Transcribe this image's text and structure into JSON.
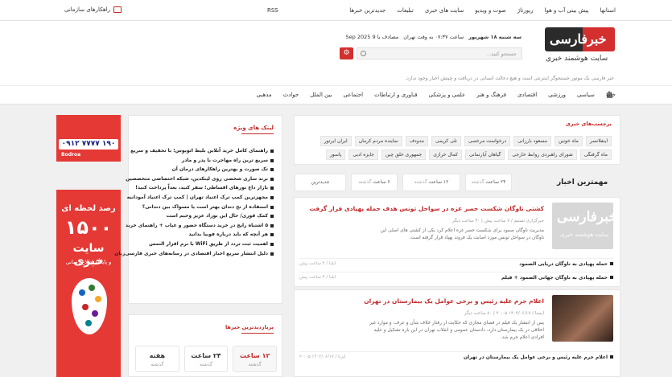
{
  "topbar": {
    "links": [
      "استانها",
      "پیش بینی آب و هوا",
      "ریورتاژ",
      "صوت و ویدیو",
      "سایت های خبری",
      "تبلیغات",
      "جدیدترین خبرها"
    ],
    "rss": "RSS",
    "org_solutions": "راهکارهای سازمانی"
  },
  "header": {
    "logo_text": "خبرفارسی",
    "site_subtitle": "سایت هوشمند خبری",
    "date_persian": "سه شنبه ۱۸ شهریور",
    "time": "ساعت ۰۷:۳۷ به وقت تهران",
    "date_greg": "مصادف با 9 Sep 2025",
    "search_placeholder": "جستجو کنید...",
    "settings_icon": "gear-icon",
    "tagline": "خبر فارسی یک موتور جستجوگر اینترنتی است و هیچ دخالت انسانی در دریافت و چینش اخبار وجود ندارد."
  },
  "mainnav": {
    "items": [
      "خانه",
      "سیاسی",
      "ورزشی",
      "اقتصادی",
      "فرهنگ و هنر",
      "علمی و پزشکی",
      "فناوری و ارتباطات",
      "اجتماعی",
      "بین الملل",
      "حوادث",
      "مذهبی"
    ]
  },
  "ads": {
    "ad1_phone": "۰۹۱۲ ۷۷۷۷ ۱۹۰",
    "ad1_brand": "Bodroa",
    "ad2_line1": "رصد لحظه ای",
    "ad2_line2": "۱۵۰۰",
    "ad2_line3": "سایت خبری",
    "ad2_line4": "و پایگاه اطلاع رسانی"
  },
  "special_links": {
    "title": "لینک های ویژه",
    "items": [
      "راهنمای کامل خرید آنلاین بلیط اتوبوس؛ با تخفیف و سریع",
      "سریع ترین راه مهاجرت با پدر و مادر",
      "تک صورت و بهترین راهکارهای درمان آن",
      "برند سازی شخصی روی لینکدین، شبکه اختصاصی متخصصین",
      "بازار داغ تورهای اقساطی؛ سفر کنید، بعداً پرداخت کنید!",
      "مجهزترین کمپ ترک اعتیاد تهران | کمپ ترک اعتیاد آمودانیه",
      "استفاده از نخ دندان بهتر است یا مسواک بین دندانی؟",
      "کمک فوری/ حال این نوزاد عزیز وخیم است",
      "۵ اشتباه رایج در خرید دستگاه حضور و غیاب + راهنمای خرید",
      "هر آنچه که باید درباره فوبیا بدانید",
      "اهمیت ثبت تردد از طریق WiFi با نرم افزار التمس",
      "دلیل انتشار سریع اخبار اقتصادی در رسانه‌های خبری فارسی‌زبان"
    ]
  },
  "popular": {
    "title": "پربازدیدترین خبرها",
    "tabs": [
      {
        "num": "۱۲ ساعت",
        "sub": "گذشته"
      },
      {
        "num": "۲۴ ساعت",
        "sub": "گذشته"
      },
      {
        "num": "هفته",
        "sub": "گذشته"
      }
    ]
  },
  "tags": {
    "title": "برچسب‌های خبری",
    "items": [
      "اینفلانسر",
      "ماه خونین",
      "مسعود بارزانی",
      "درخواست مرخصی",
      "تلی کریمی",
      "مدودف",
      "نماینده مردم کرمان",
      "ایران ایرتور",
      "ماه گرفتگی",
      "شورای راهبردی روابط خارجی",
      "گیاهان آپارتمانی",
      "کمال خرازی",
      "جمهوری خلق چین",
      "جایزه ادبی",
      "پاسور"
    ]
  },
  "important": {
    "title": "مهمترین اخبار",
    "filters": [
      {
        "num": "۲۴ ساعت",
        "sub": "گذشته"
      },
      {
        "num": "۱۲ ساعت",
        "sub": "گذشته"
      },
      {
        "num": "۶ ساعت",
        "sub": "گذشته"
      },
      {
        "num": "جدیدترین",
        "sub": ""
      }
    ]
  },
  "news": [
    {
      "title": "کشتی ناوگان شکست حصر غزه در سواحل تونس هدف حمله پهپادی قرار گرفت",
      "meta": "خبرگزاری تسنیم / ۷ ساعت پیش | ۳۰ ساعت دیگر",
      "summary": "مدیریت ناوگان صمود برای شکست حصر غزه اعلام کرد یکی از کشتی های اصلی این ناوگان در سواحل تونس مورد اصابت یک فروند پهپاد قرار گرفته است.",
      "subs": [
        {
          "text": "حمله پهپادی به ناوگان دریایی الصمود",
          "time": "ایلنا / ۴ ساعت پیش"
        },
        {
          "text": "حمله پهپادی به ناوگان جهانی الصمود + فیلم",
          "time": "ایلنا / ۴ ساعت پیش"
        }
      ]
    },
    {
      "title": "اعلام جرم علیه رئیس و برخی عوامل یک بیمارستان در تهران",
      "meta": "ایسنا / ۱۴۰۴/۰۶/۱۷ ۲۰:۰۵ | ۸۰ ساعت دیگر",
      "summary": "پس از انتشار یک فیلم در فضای مجازی که حکایت از رفتار خلاف شأن و عرف، و موارد غیر اخلاقی در یک بیمارستان دارد، دادستان عمومی و انقلاب تهران در این باره تشکیل و علیه افرادی اعلام جرم شد.",
      "subs": [
        {
          "text": "اعلام جرم علیه رئیس و برخی عوامل یک بیمارستان در تهران",
          "time": "ایرنا / ۱۴۰۴/۰۶/۱۷ ۲۰:۰۵"
        }
      ]
    }
  ]
}
